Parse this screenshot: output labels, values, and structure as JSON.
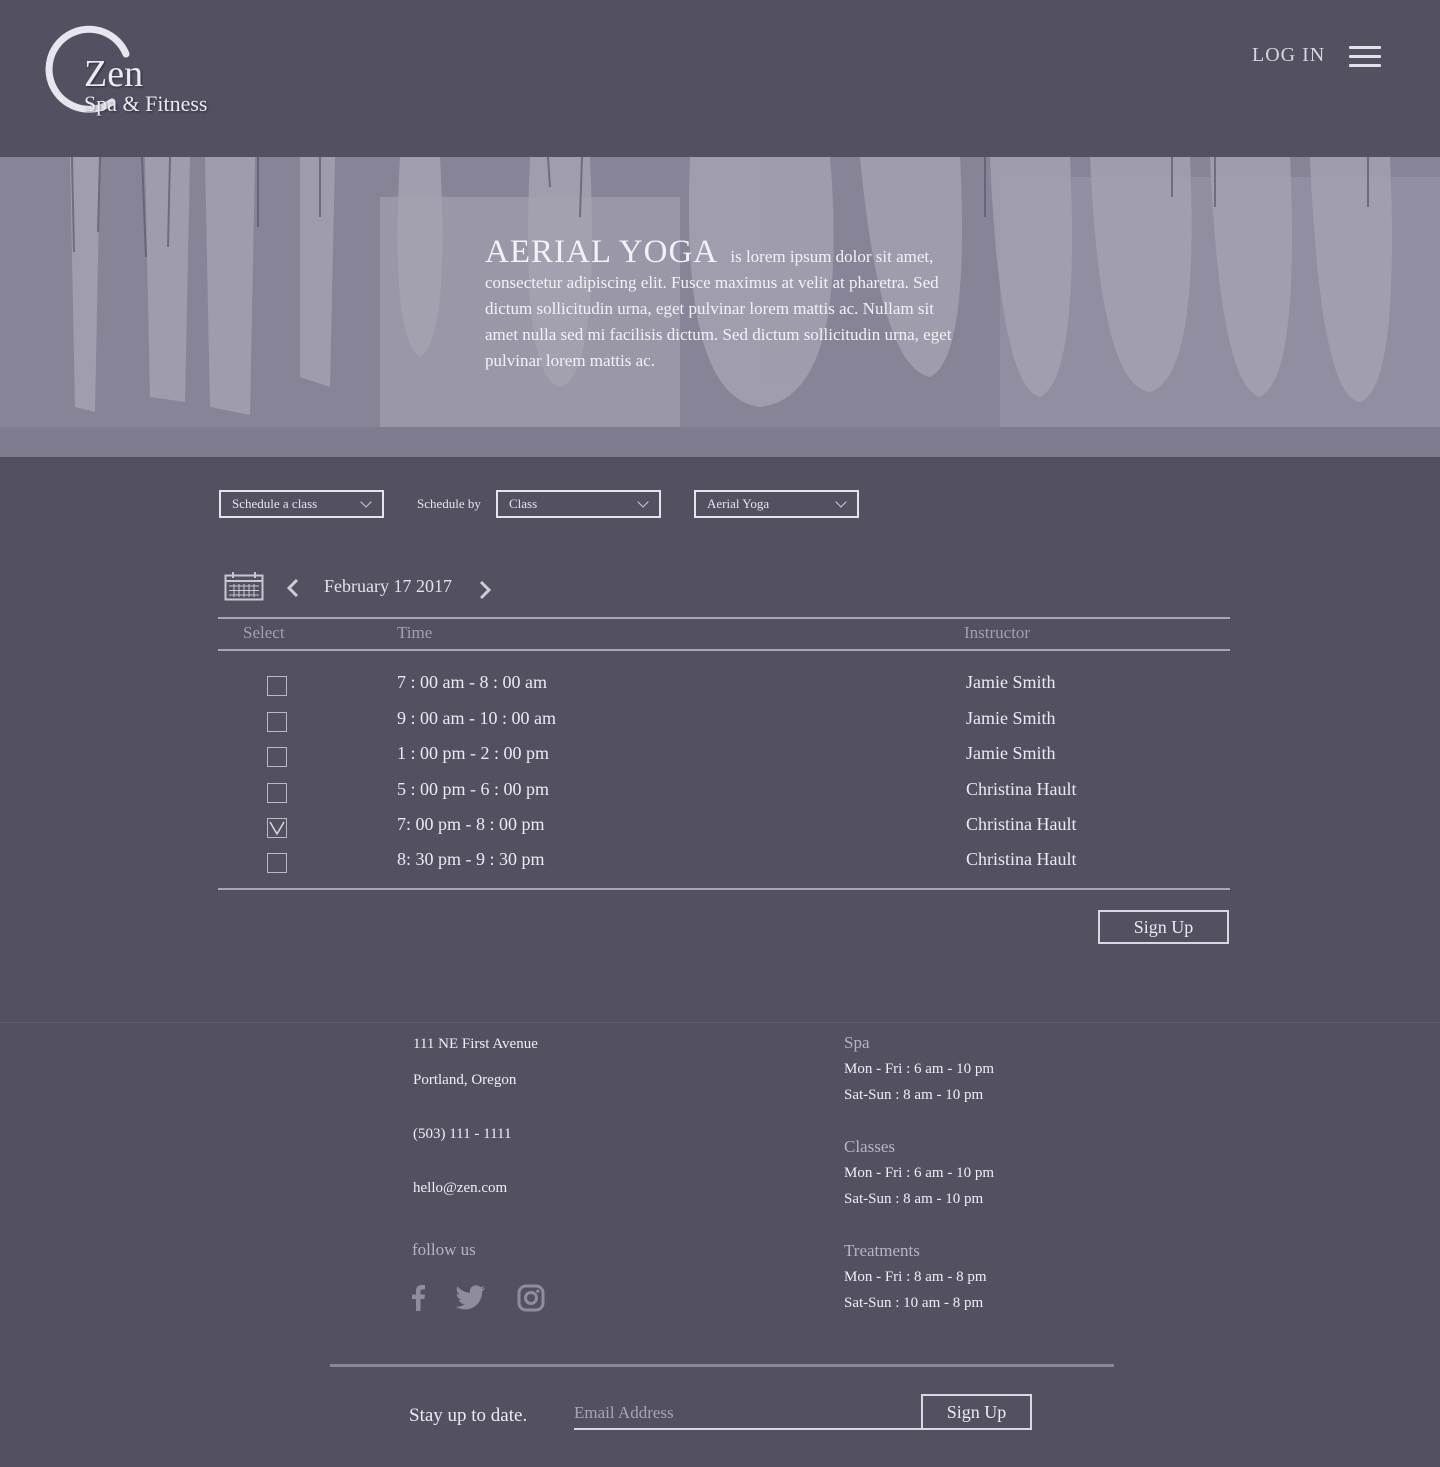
{
  "brand": {
    "name": "Zen",
    "tagline": "Spa & Fitness"
  },
  "header": {
    "login_label": "LOG IN"
  },
  "hero": {
    "title": "AERIAL YOGA",
    "description": "is lorem ipsum dolor sit amet, consectetur adipiscing elit. Fusce maximus at velit at pharetra. Sed dictum sollicitudin urna, eget pulvinar lorem mattis ac. Nullam sit amet nulla sed mi facilisis dictum. Sed dictum sollicitudin urna, eget pulvinar lorem mattis ac."
  },
  "filters": {
    "action_select": "Schedule a class",
    "schedule_by_label": "Schedule by",
    "schedule_by_select": "Class",
    "class_select": "Aerial Yoga"
  },
  "date_nav": {
    "date": "February 17 2017"
  },
  "table": {
    "headers": {
      "select": "Select",
      "time": "Time",
      "instructor": "Instructor"
    },
    "rows": [
      {
        "time": "7 : 00 am - 8 : 00 am",
        "instructor": "Jamie Smith",
        "checked": false
      },
      {
        "time": "9 : 00 am - 10 : 00 am",
        "instructor": "Jamie Smith",
        "checked": false
      },
      {
        "time": "1 : 00 pm - 2 : 00 pm",
        "instructor": "Jamie Smith",
        "checked": false
      },
      {
        "time": "5 : 00 pm - 6 : 00 pm",
        "instructor": "Christina Hault",
        "checked": false
      },
      {
        "time": "7: 00 pm - 8 : 00 pm",
        "instructor": "Christina Hault",
        "checked": true
      },
      {
        "time": "8: 30 pm - 9 : 30 pm",
        "instructor": "Christina Hault",
        "checked": false
      }
    ],
    "signup_label": "Sign Up"
  },
  "footer": {
    "address_line1": "111 NE First Avenue",
    "address_line2": "Portland, Oregon",
    "phone": "(503) 111 - 1111",
    "email": "hello@zen.com",
    "follow_label": "follow us",
    "hours": [
      {
        "title": "Spa",
        "weekday": "Mon - Fri :  6 am - 10 pm",
        "weekend": "Sat-Sun : 8 am - 10 pm"
      },
      {
        "title": "Classes",
        "weekday": "Mon - Fri :  6 am - 10 pm",
        "weekend": "Sat-Sun :  8 am - 10 pm"
      },
      {
        "title": "Treatments",
        "weekday": "Mon - Fri :  8 am - 8 pm",
        "weekend": "Sat-Sun :  10 am - 8 pm"
      }
    ]
  },
  "newsletter": {
    "label": "Stay up to date.",
    "email_placeholder": "Email Address",
    "signup_label": "Sign Up"
  },
  "icons": [
    "logo-ring-icon",
    "menu-icon",
    "calendar-icon",
    "chevron-left-icon",
    "chevron-right-icon",
    "checkmark-icon",
    "facebook-icon",
    "twitter-icon",
    "instagram-icon"
  ],
  "colors": {
    "background": "#535062",
    "hero": "#858295",
    "text": "#ece9f2",
    "muted": "#a3a0ae"
  }
}
